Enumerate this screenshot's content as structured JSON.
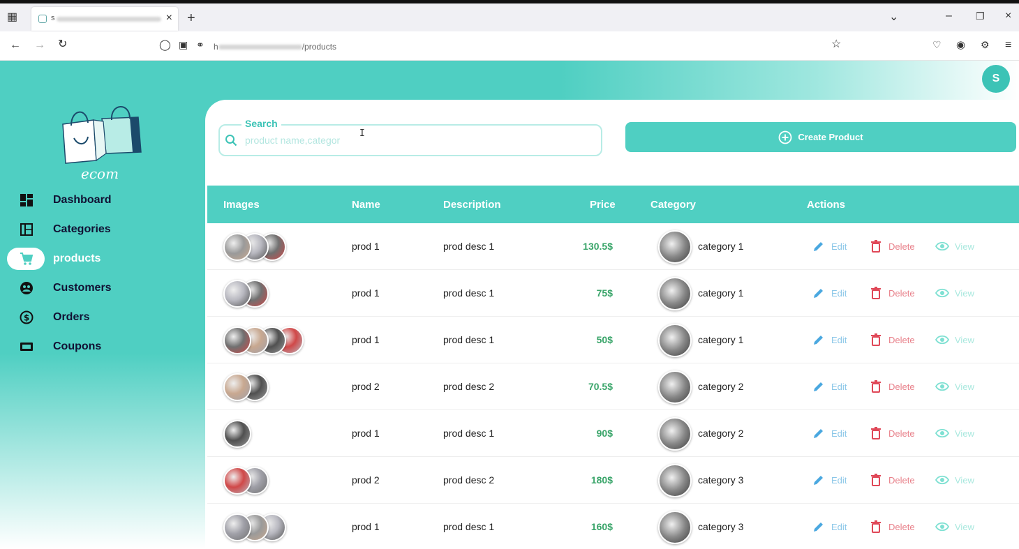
{
  "browser": {
    "tab_title": "s",
    "url_prefix": "h",
    "url_path": "/products"
  },
  "user": {
    "initial": "S"
  },
  "brand": {
    "name": "ecom"
  },
  "sidebar": {
    "items": [
      {
        "label": "Dashboard",
        "icon": "dashboard-icon"
      },
      {
        "label": "Categories",
        "icon": "categories-icon"
      },
      {
        "label": "products",
        "icon": "cart-icon",
        "active": true
      },
      {
        "label": "Customers",
        "icon": "customers-icon"
      },
      {
        "label": "Orders",
        "icon": "orders-icon"
      },
      {
        "label": "Coupons",
        "icon": "coupons-icon"
      }
    ]
  },
  "search": {
    "label": "Search",
    "placeholder": "product name,categor"
  },
  "create_button": {
    "label": "Create Product"
  },
  "table": {
    "headers": [
      "Images",
      "Name",
      "Description",
      "Price",
      "Category",
      "Actions"
    ],
    "rows": [
      {
        "name": "prod 1",
        "description": "prod desc 1",
        "price": "130.5$",
        "category": "category 1",
        "image_count": 3
      },
      {
        "name": "prod 1",
        "description": "prod desc 1",
        "price": "75$",
        "category": "category 1",
        "image_count": 2
      },
      {
        "name": "prod 1",
        "description": "prod desc 1",
        "price": "50$",
        "category": "category 1",
        "image_count": 4
      },
      {
        "name": "prod 2",
        "description": "prod desc 2",
        "price": "70.5$",
        "category": "category 2",
        "image_count": 2
      },
      {
        "name": "prod 1",
        "description": "prod desc 1",
        "price": "90$",
        "category": "category 2",
        "image_count": 1
      },
      {
        "name": "prod 2",
        "description": "prod desc 2",
        "price": "180$",
        "category": "category 3",
        "image_count": 2
      },
      {
        "name": "prod 1",
        "description": "prod desc 1",
        "price": "160$",
        "category": "category 3",
        "image_count": 3
      }
    ],
    "actions": {
      "edit": "Edit",
      "delete": "Delete",
      "view": "View"
    }
  },
  "colors": {
    "accent": "#4fcfc2",
    "price": "#3aa56a",
    "edit": "#8ac6e8",
    "delete": "#e8808a",
    "view": "#a8e8de"
  }
}
